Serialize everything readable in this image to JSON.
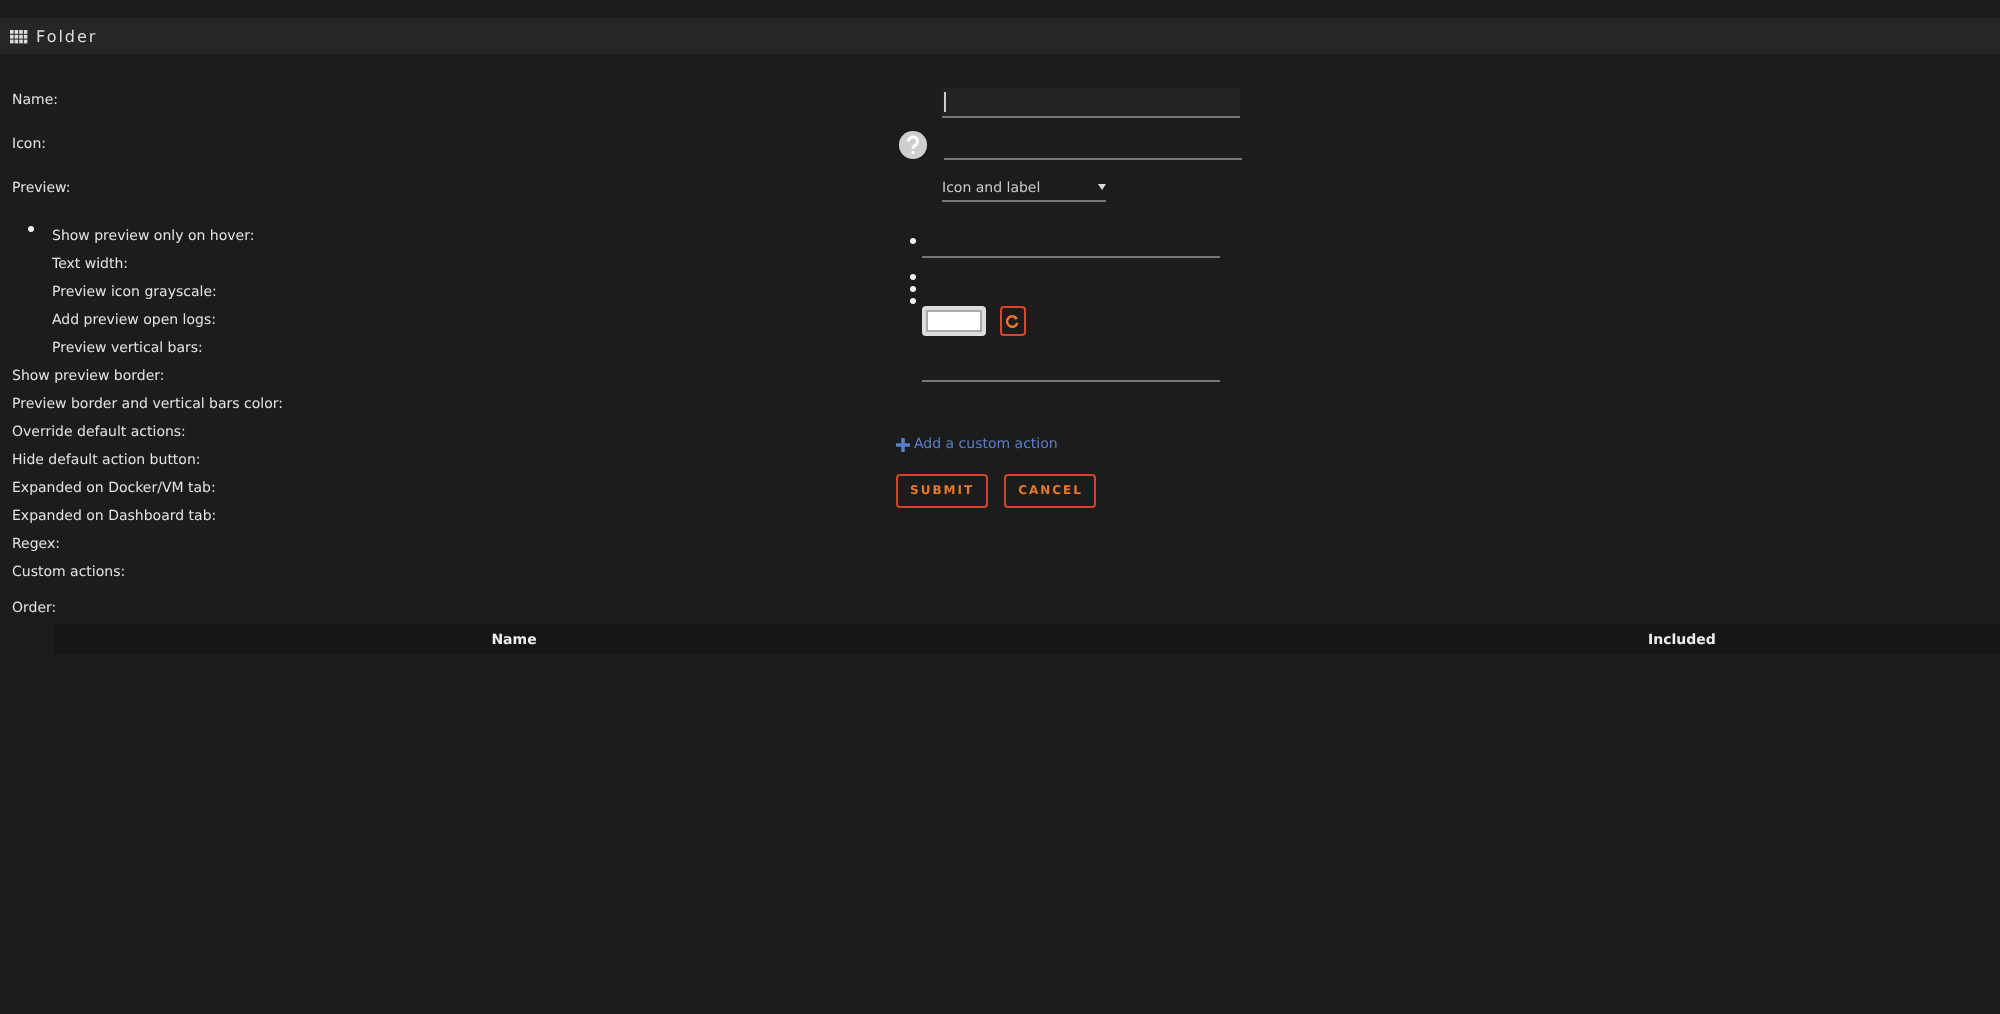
{
  "header": {
    "title": "Folder"
  },
  "labels": [
    {
      "text": "Name:",
      "kind": "main"
    },
    {
      "text": "Icon:",
      "kind": "main"
    },
    {
      "text": "Preview:",
      "kind": "main"
    },
    {
      "text": "Show preview only on hover:",
      "kind": "sub"
    },
    {
      "text": "Text width:",
      "kind": "sub"
    },
    {
      "text": "Preview icon grayscale:",
      "kind": "sub"
    },
    {
      "text": "Add preview open logs:",
      "kind": "sub"
    },
    {
      "text": "Preview vertical bars:",
      "kind": "sub"
    },
    {
      "text": "Show preview border:",
      "kind": "main"
    },
    {
      "text": "Preview border and vertical bars color:",
      "kind": "main"
    },
    {
      "text": "Override default actions:",
      "kind": "main"
    },
    {
      "text": "Hide default action button:",
      "kind": "main"
    },
    {
      "text": "Expanded on Docker/VM tab:",
      "kind": "main"
    },
    {
      "text": "Expanded on Dashboard tab:",
      "kind": "main"
    },
    {
      "text": "Regex:",
      "kind": "main"
    },
    {
      "text": "Custom actions:",
      "kind": "main"
    }
  ],
  "preview_select": {
    "value": "Icon and label"
  },
  "add_action": "Add a custom action",
  "buttons": [
    "SUBMIT",
    "CANCEL"
  ],
  "order": {
    "label": "Order:",
    "columns": [
      "Name",
      "Included"
    ]
  }
}
